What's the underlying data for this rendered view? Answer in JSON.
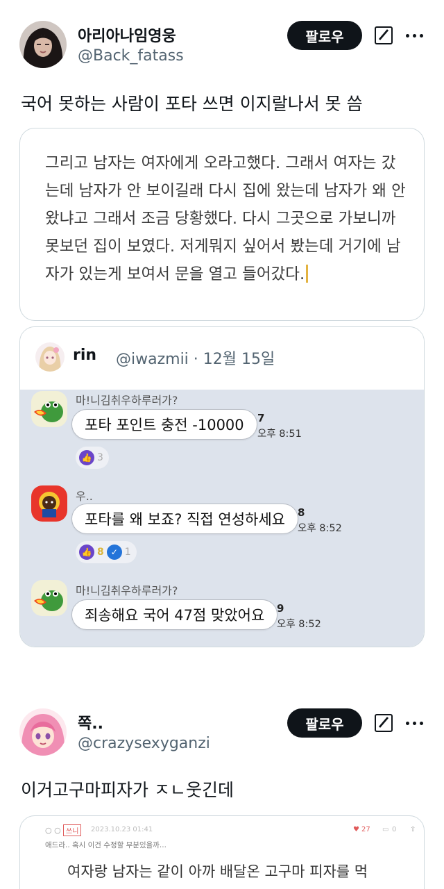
{
  "post1": {
    "display_name": "아리아나임영웅",
    "handle": "@Back_fatass",
    "follow_label": "팔로우",
    "text": "국어 못하는 사람이 포타 쓰면 이지랄나서 못 씀",
    "media_text": "그리고 남자는 여자에게 오라고했다. 그래서 여자는 갔는데 남자가 안 보이길래 다시 집에 왔는데 남자가 왜 안왔냐고 그래서 조금 당황했다. 다시 그곳으로 가보니까 못보던 집이 보였다. 저게뭐지 싶어서 봤는데 거기에 남자가 있는게 보여서 문을 열고 들어갔다.",
    "quote": {
      "name": "rin",
      "handle": "@iwazmii · 12월 15일",
      "messages": [
        {
          "sender": "마!니김취우하루러가?",
          "text": "포타 포인트 충전 -10000",
          "unread": "7",
          "time": "오후 8:51",
          "reactions": [
            {
              "icon": "thumbs-up",
              "count": "3"
            }
          ]
        },
        {
          "sender": "우..",
          "text": "포타를 왜 보죠? 직접 연성하세요",
          "unread": "8",
          "time": "오후 8:52",
          "reactions": [
            {
              "icon": "thumbs-up",
              "count": "8"
            },
            {
              "icon": "check",
              "count": "1"
            }
          ]
        },
        {
          "sender": "마!니김취우하루러가?",
          "text": "죄송해요 국어 47점 맞았어요",
          "unread": "9",
          "time": "오후 8:52"
        }
      ]
    }
  },
  "post2": {
    "display_name": "쪽..",
    "handle": "@crazysexyganzi",
    "follow_label": "팔로우",
    "text": "이거고구마피자가 ㅈㄴ웃긴데",
    "media": {
      "meta_tag": "쓰니",
      "meta_date": "2023.10.23 01:41",
      "meta_likes": "27",
      "meta_comments": "0",
      "subtitle": "애드라.. 혹시 이건 수정할 부분있을까...",
      "text": "여자랑 남자는 같이 아까 배달온 고구마 피자를 먹"
    }
  },
  "colors": {
    "follow_bg": "#0f1419",
    "handle_gray": "#536471",
    "chat_bg": "#dde3ec",
    "react_purple": "#6a45c9",
    "react_blue": "#2474d9"
  }
}
